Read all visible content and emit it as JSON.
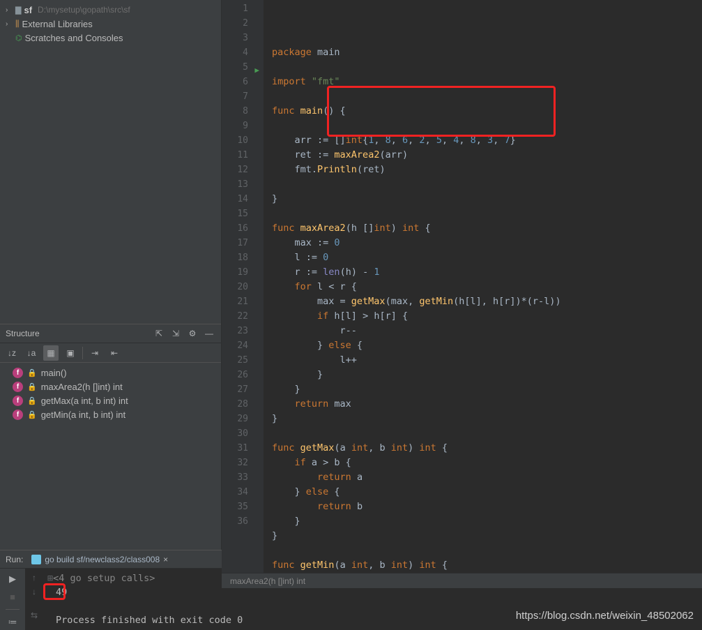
{
  "project": {
    "root_name": "sf",
    "root_path": "D:\\mysetup\\gopath\\src\\sf",
    "external_libs": "External Libraries",
    "scratches": "Scratches and Consoles"
  },
  "structure": {
    "title": "Structure",
    "items": [
      {
        "name": "main()"
      },
      {
        "name": "maxArea2(h []int) int"
      },
      {
        "name": "getMax(a int, b int) int"
      },
      {
        "name": "getMin(a int, b int) int"
      }
    ]
  },
  "code": {
    "lines": [
      {
        "n": 1,
        "seg": [
          [
            "kw",
            "package"
          ],
          [
            "id",
            " main"
          ]
        ]
      },
      {
        "n": 2,
        "seg": []
      },
      {
        "n": 3,
        "seg": [
          [
            "kw",
            "import"
          ],
          [
            "id",
            " "
          ],
          [
            "str",
            "\"fmt\""
          ]
        ]
      },
      {
        "n": 4,
        "seg": []
      },
      {
        "n": 5,
        "run": true,
        "seg": [
          [
            "kw",
            "func"
          ],
          [
            "id",
            " "
          ],
          [
            "fn",
            "main"
          ],
          [
            "punc",
            "() {"
          ]
        ]
      },
      {
        "n": 6,
        "seg": []
      },
      {
        "n": 7,
        "seg": [
          [
            "id",
            "    arr "
          ],
          [
            "punc",
            ":= []"
          ],
          [
            "kw",
            "int"
          ],
          [
            "punc",
            "{"
          ],
          [
            "num",
            "1"
          ],
          [
            "punc",
            ", "
          ],
          [
            "num",
            "8"
          ],
          [
            "punc",
            ", "
          ],
          [
            "num",
            "6"
          ],
          [
            "punc",
            ", "
          ],
          [
            "num",
            "2"
          ],
          [
            "punc",
            ", "
          ],
          [
            "num",
            "5"
          ],
          [
            "punc",
            ", "
          ],
          [
            "num",
            "4"
          ],
          [
            "punc",
            ", "
          ],
          [
            "num",
            "8"
          ],
          [
            "punc",
            ", "
          ],
          [
            "num",
            "3"
          ],
          [
            "punc",
            ", "
          ],
          [
            "num",
            "7"
          ],
          [
            "punc",
            "}"
          ]
        ]
      },
      {
        "n": 8,
        "seg": [
          [
            "id",
            "    ret "
          ],
          [
            "punc",
            ":= "
          ],
          [
            "fn",
            "maxArea2"
          ],
          [
            "punc",
            "(arr)"
          ]
        ]
      },
      {
        "n": 9,
        "seg": [
          [
            "id",
            "    fmt."
          ],
          [
            "fn",
            "Println"
          ],
          [
            "punc",
            "(ret)"
          ]
        ]
      },
      {
        "n": 10,
        "seg": []
      },
      {
        "n": 11,
        "seg": [
          [
            "punc",
            "}"
          ]
        ]
      },
      {
        "n": 12,
        "seg": []
      },
      {
        "n": 13,
        "seg": [
          [
            "kw",
            "func"
          ],
          [
            "id",
            " "
          ],
          [
            "fn",
            "maxArea2"
          ],
          [
            "punc",
            "(h []"
          ],
          [
            "kw",
            "int"
          ],
          [
            "punc",
            ") "
          ],
          [
            "kw",
            "int"
          ],
          [
            "punc",
            " {"
          ]
        ]
      },
      {
        "n": 14,
        "seg": [
          [
            "id",
            "    max "
          ],
          [
            "punc",
            ":= "
          ],
          [
            "num",
            "0"
          ]
        ]
      },
      {
        "n": 15,
        "seg": [
          [
            "id",
            "    l "
          ],
          [
            "punc",
            ":= "
          ],
          [
            "num",
            "0"
          ]
        ]
      },
      {
        "n": 16,
        "seg": [
          [
            "id",
            "    r "
          ],
          [
            "punc",
            ":= "
          ],
          [
            "builtin",
            "len"
          ],
          [
            "punc",
            "(h) - "
          ],
          [
            "num",
            "1"
          ]
        ]
      },
      {
        "n": 17,
        "seg": [
          [
            "id",
            "    "
          ],
          [
            "kw",
            "for"
          ],
          [
            "id",
            " l < r {"
          ]
        ]
      },
      {
        "n": 18,
        "seg": [
          [
            "id",
            "        max = "
          ],
          [
            "fn",
            "getMax"
          ],
          [
            "punc",
            "(max, "
          ],
          [
            "fn",
            "getMin"
          ],
          [
            "punc",
            "(h[l], h[r])*(r-l))"
          ]
        ]
      },
      {
        "n": 19,
        "seg": [
          [
            "id",
            "        "
          ],
          [
            "kw",
            "if"
          ],
          [
            "id",
            " h[l] > h[r] {"
          ]
        ]
      },
      {
        "n": 20,
        "seg": [
          [
            "id",
            "            r--"
          ]
        ]
      },
      {
        "n": 21,
        "seg": [
          [
            "id",
            "        } "
          ],
          [
            "kw",
            "else"
          ],
          [
            "id",
            " {"
          ]
        ]
      },
      {
        "n": 22,
        "seg": [
          [
            "id",
            "            l++"
          ]
        ]
      },
      {
        "n": 23,
        "seg": [
          [
            "id",
            "        }"
          ]
        ]
      },
      {
        "n": 24,
        "seg": [
          [
            "id",
            "    }"
          ]
        ]
      },
      {
        "n": 25,
        "seg": [
          [
            "id",
            "    "
          ],
          [
            "kw",
            "return"
          ],
          [
            "id",
            " max"
          ]
        ]
      },
      {
        "n": 26,
        "seg": [
          [
            "punc",
            "}"
          ]
        ]
      },
      {
        "n": 27,
        "seg": []
      },
      {
        "n": 28,
        "seg": [
          [
            "kw",
            "func"
          ],
          [
            "id",
            " "
          ],
          [
            "fn",
            "getMax"
          ],
          [
            "punc",
            "(a "
          ],
          [
            "kw",
            "int"
          ],
          [
            "punc",
            ", b "
          ],
          [
            "kw",
            "int"
          ],
          [
            "punc",
            ") "
          ],
          [
            "kw",
            "int"
          ],
          [
            "punc",
            " {"
          ]
        ]
      },
      {
        "n": 29,
        "seg": [
          [
            "id",
            "    "
          ],
          [
            "kw",
            "if"
          ],
          [
            "id",
            " a > b {"
          ]
        ]
      },
      {
        "n": 30,
        "seg": [
          [
            "id",
            "        "
          ],
          [
            "kw",
            "return"
          ],
          [
            "id",
            " a"
          ]
        ]
      },
      {
        "n": 31,
        "seg": [
          [
            "id",
            "    } "
          ],
          [
            "kw",
            "else"
          ],
          [
            "id",
            " {"
          ]
        ]
      },
      {
        "n": 32,
        "seg": [
          [
            "id",
            "        "
          ],
          [
            "kw",
            "return"
          ],
          [
            "id",
            " b"
          ]
        ]
      },
      {
        "n": 33,
        "seg": [
          [
            "id",
            "    }"
          ]
        ]
      },
      {
        "n": 34,
        "seg": [
          [
            "punc",
            "}"
          ]
        ]
      },
      {
        "n": 35,
        "seg": []
      },
      {
        "n": 36,
        "seg": [
          [
            "kw",
            "func"
          ],
          [
            "id",
            " "
          ],
          [
            "fn",
            "getMin"
          ],
          [
            "punc",
            "(a "
          ],
          [
            "kw",
            "int"
          ],
          [
            "punc",
            ", b "
          ],
          [
            "kw",
            "int"
          ],
          [
            "punc",
            ") "
          ],
          [
            "kw",
            "int"
          ],
          [
            "punc",
            " {"
          ]
        ]
      }
    ],
    "breadcrumb": "maxArea2(h []int) int"
  },
  "run": {
    "label": "Run:",
    "tab": "go build sf/newclass2/class008",
    "setup": "<4 go setup calls>",
    "output": "49",
    "finished": "Process finished with exit code 0"
  },
  "watermark": "https://blog.csdn.net/weixin_48502062"
}
